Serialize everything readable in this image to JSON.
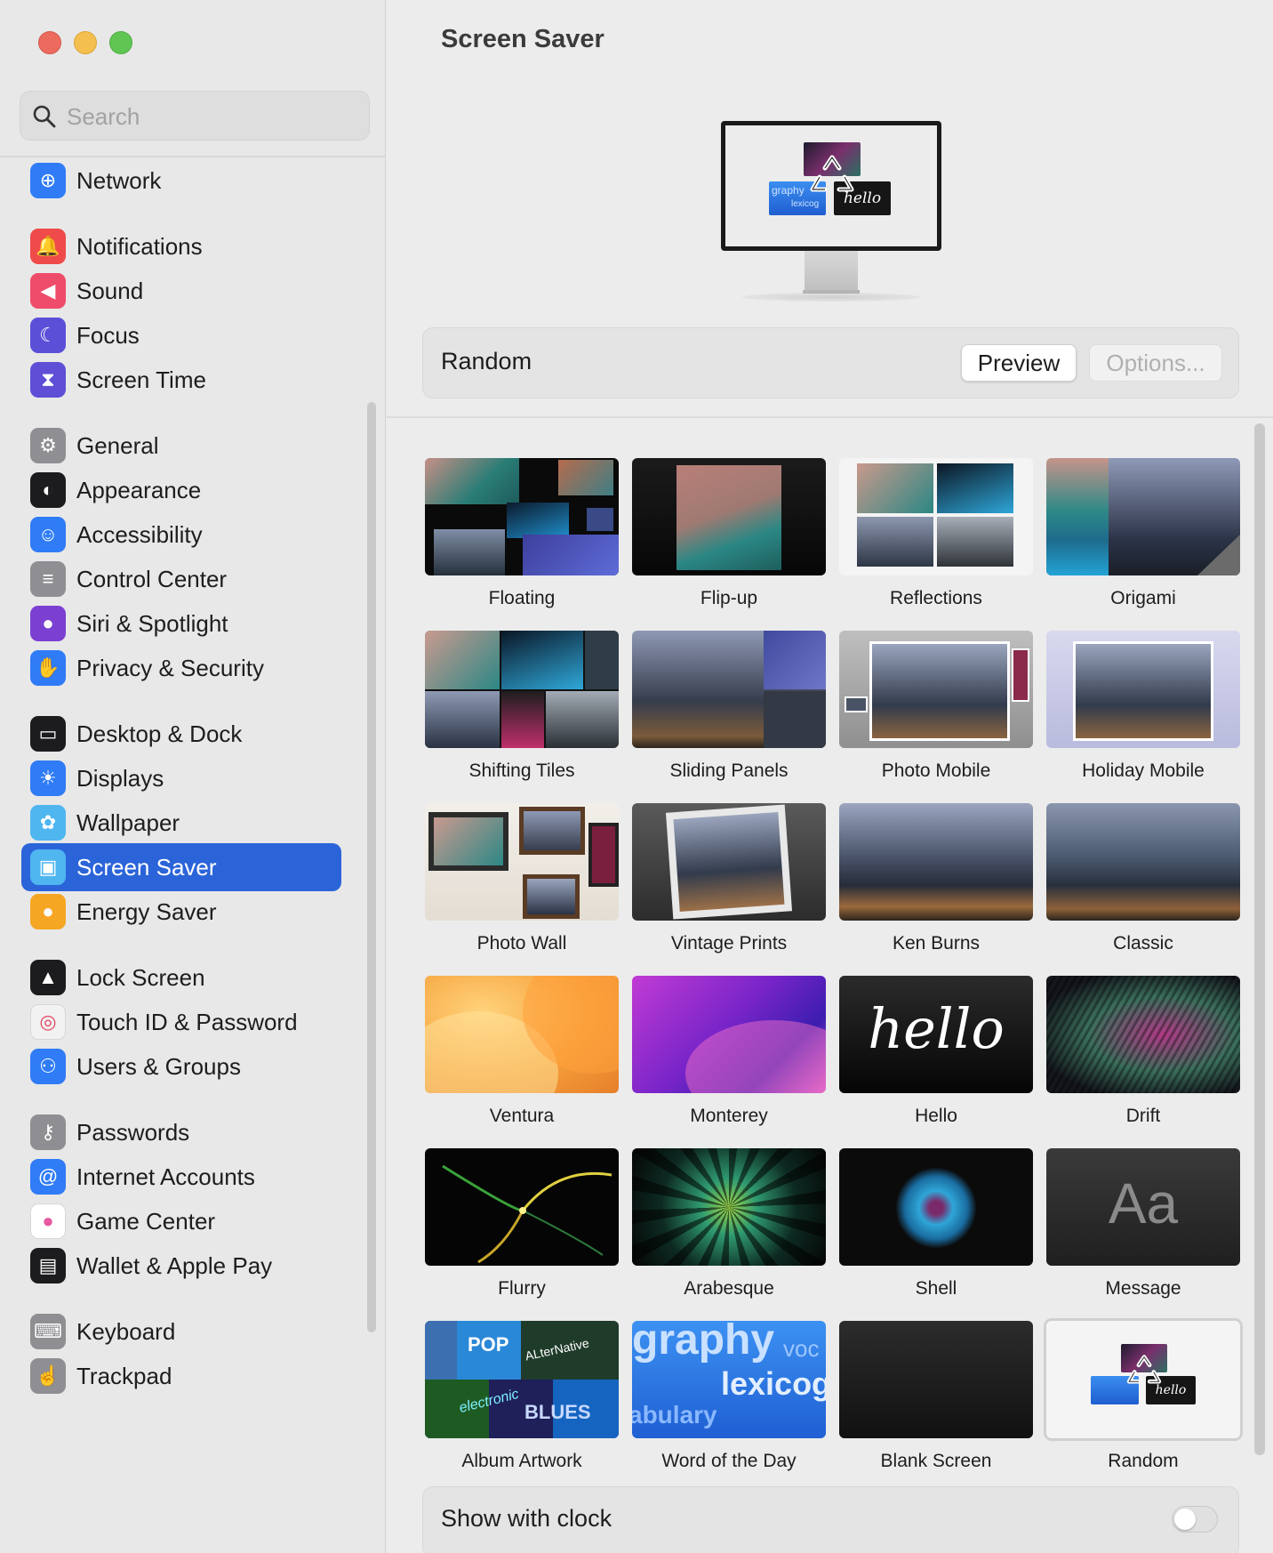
{
  "window": {
    "traffic_lights": [
      "close",
      "minimize",
      "zoom"
    ]
  },
  "search": {
    "placeholder": "Search",
    "value": ""
  },
  "sidebar": {
    "items": [
      {
        "label": "Network",
        "icon": "globe-icon",
        "color": "#2f7cf6"
      },
      {
        "label": "Notifications",
        "icon": "bell-icon",
        "color": "#ef4b4b"
      },
      {
        "label": "Sound",
        "icon": "speaker-icon",
        "color": "#ef4b6a"
      },
      {
        "label": "Focus",
        "icon": "moon-icon",
        "color": "#5b4fd8"
      },
      {
        "label": "Screen Time",
        "icon": "hourglass-icon",
        "color": "#5e4fd6"
      },
      {
        "label": "General",
        "icon": "gear-icon",
        "color": "#8e8e93"
      },
      {
        "label": "Appearance",
        "icon": "appearance-icon",
        "color": "#1c1c1e"
      },
      {
        "label": "Accessibility",
        "icon": "accessibility-icon",
        "color": "#2f7cf6"
      },
      {
        "label": "Control Center",
        "icon": "toggles-icon",
        "color": "#8e8e93"
      },
      {
        "label": "Siri & Spotlight",
        "icon": "siri-icon",
        "color": "#7b3fd1"
      },
      {
        "label": "Privacy & Security",
        "icon": "hand-icon",
        "color": "#2f7cf6"
      },
      {
        "label": "Desktop & Dock",
        "icon": "dock-icon",
        "color": "#1c1c1e"
      },
      {
        "label": "Displays",
        "icon": "sun-icon",
        "color": "#2f7cf6"
      },
      {
        "label": "Wallpaper",
        "icon": "flower-icon",
        "color": "#4fb6f0"
      },
      {
        "label": "Screen Saver",
        "icon": "screensaver-icon",
        "color": "#4fb6f0"
      },
      {
        "label": "Energy Saver",
        "icon": "lightbulb-icon",
        "color": "#f5a623"
      },
      {
        "label": "Lock Screen",
        "icon": "lock-icon",
        "color": "#1c1c1e"
      },
      {
        "label": "Touch ID & Password",
        "icon": "fingerprint-icon",
        "color": "#f2f2f2"
      },
      {
        "label": "Users & Groups",
        "icon": "users-icon",
        "color": "#2f7cf6"
      },
      {
        "label": "Passwords",
        "icon": "key-icon",
        "color": "#8e8e93"
      },
      {
        "label": "Internet Accounts",
        "icon": "at-icon",
        "color": "#2f7cf6"
      },
      {
        "label": "Game Center",
        "icon": "game-center-icon",
        "color": "#ffffff"
      },
      {
        "label": "Wallet & Apple Pay",
        "icon": "wallet-icon",
        "color": "#1c1c1e"
      },
      {
        "label": "Keyboard",
        "icon": "keyboard-icon",
        "color": "#8e8e93"
      },
      {
        "label": "Trackpad",
        "icon": "trackpad-icon",
        "color": "#8e8e93"
      }
    ],
    "selected": "Screen Saver",
    "accent": "#2b64d9"
  },
  "main": {
    "title": "Screen Saver",
    "current": {
      "label": "Random",
      "preview_label": "Preview",
      "options_label": "Options..."
    },
    "savers": [
      {
        "label": "Floating"
      },
      {
        "label": "Flip-up"
      },
      {
        "label": "Reflections"
      },
      {
        "label": "Origami"
      },
      {
        "label": "Shifting Tiles"
      },
      {
        "label": "Sliding Panels"
      },
      {
        "label": "Photo Mobile"
      },
      {
        "label": "Holiday Mobile"
      },
      {
        "label": "Photo Wall"
      },
      {
        "label": "Vintage Prints"
      },
      {
        "label": "Ken Burns"
      },
      {
        "label": "Classic"
      },
      {
        "label": "Ventura"
      },
      {
        "label": "Monterey"
      },
      {
        "label": "Hello"
      },
      {
        "label": "Drift"
      },
      {
        "label": "Flurry"
      },
      {
        "label": "Arabesque"
      },
      {
        "label": "Shell"
      },
      {
        "label": "Message"
      },
      {
        "label": "Album Artwork"
      },
      {
        "label": "Word of the Day"
      },
      {
        "label": "Blank Screen"
      },
      {
        "label": "Random",
        "selected": true
      }
    ],
    "thumb_text": {
      "hello": "hello",
      "message": "Aa",
      "word_big": "graphy",
      "word_voc": "voc",
      "word_lex": "lexicog",
      "word_abu": "abulary",
      "album_pop": "POP",
      "album_alt": "ALterNative",
      "album_elec": "electronic",
      "album_blues": "BLUES",
      "mini_graphy": "graphy",
      "mini_lexico": "lexicog",
      "mini_hello": "hello"
    },
    "show_with_clock": {
      "label": "Show with clock",
      "on": false
    }
  }
}
